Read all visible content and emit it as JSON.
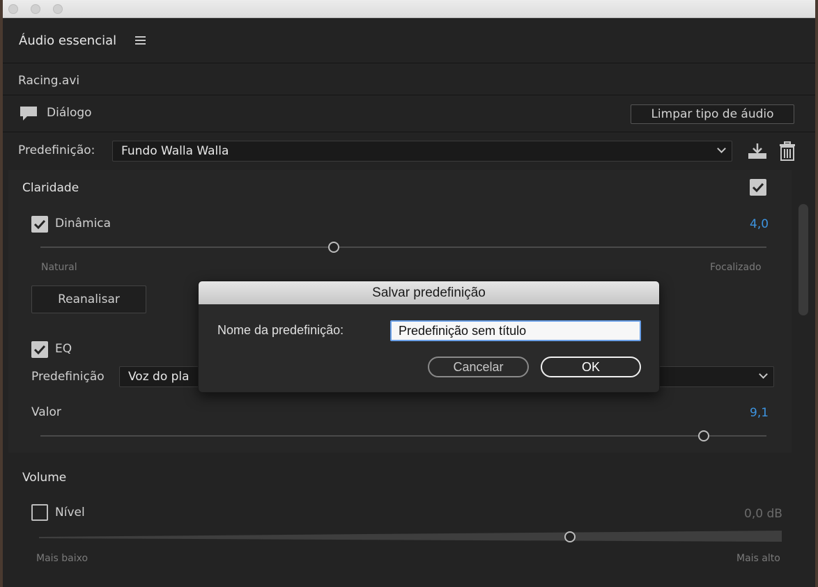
{
  "panel": {
    "title": "Áudio essencial",
    "clip_name": "Racing.avi",
    "audio_type": "Diálogo",
    "clear_button": "Limpar tipo de áudio",
    "preset_label": "Predefinição:",
    "preset_value": "Fundo Walla Walla"
  },
  "clarity": {
    "title": "Claridade",
    "enabled": true,
    "dynamics": {
      "label": "Dinâmica",
      "checked": true,
      "value": "4,0",
      "slider_fraction": 0.5,
      "min_label": "Natural",
      "max_label": "Focalizado"
    },
    "reanalyze_button": "Reanalisar",
    "eq": {
      "label": "EQ",
      "checked": true,
      "preset_label": "Predefinição",
      "preset_value": "Voz do pla",
      "amount_label": "Valor",
      "value": "9,1",
      "slider_fraction": 0.91
    }
  },
  "volume": {
    "title": "Volume",
    "level": {
      "label": "Nível",
      "checked": false,
      "value": "0,0 dB",
      "slider_fraction": 0.72,
      "min_label": "Mais baixo",
      "max_label": "Mais alto"
    }
  },
  "modal": {
    "title": "Salvar predefinição",
    "name_label": "Nome da predefinição:",
    "name_value": "Predefinição sem título",
    "cancel_button": "Cancelar",
    "ok_button": "OK"
  },
  "colors": {
    "accent_value": "#3d94e0",
    "panel_bg": "#232323"
  }
}
